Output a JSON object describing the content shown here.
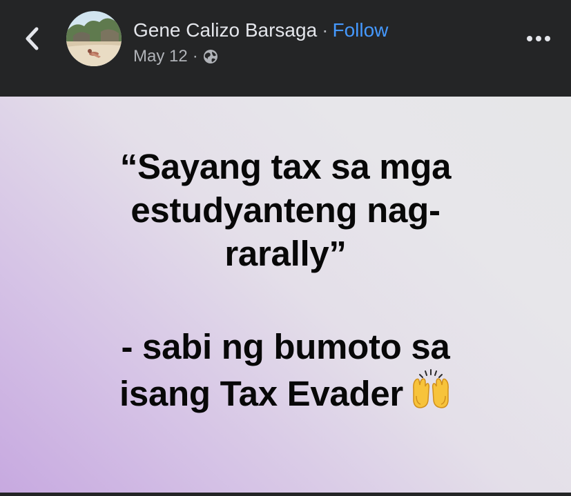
{
  "header": {
    "author_name": "Gene Calizo Barsaga",
    "separator": "·",
    "follow_label": "Follow",
    "date": "May 12",
    "meta_separator": "·",
    "back_icon": "chevron-left-icon",
    "privacy_icon": "globe-icon",
    "more_icon": "more-horizontal-icon"
  },
  "post": {
    "lines": [
      "“Sayang tax sa mga",
      "estudyanteng nag-",
      "rarally”",
      "- sabi ng bumoto sa",
      "isang Tax Evader"
    ],
    "emoji": "raising-hands-emoji"
  },
  "colors": {
    "header_bg": "#242526",
    "name_text": "#e4e6eb",
    "meta_text": "#b0b3b8",
    "follow_link": "#4599ff",
    "post_text": "#080808"
  }
}
